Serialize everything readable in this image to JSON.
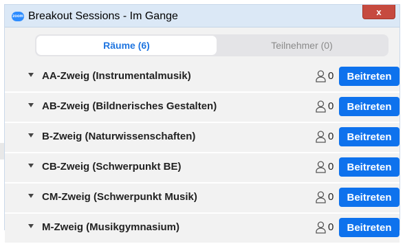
{
  "window": {
    "title": "Breakout Sessions - Im Gange",
    "app_icon_text": "zoom",
    "close_label": "x"
  },
  "tabs": [
    {
      "label": "Räume (6)",
      "active": true
    },
    {
      "label": "Teilnehmer (0)",
      "active": false
    }
  ],
  "rooms": [
    {
      "name": "AA-Zweig (Instrumentalmusik)",
      "count": "0",
      "join_label": "Beitreten"
    },
    {
      "name": "AB-Zweig (Bildnerisches Gestalten)",
      "count": "0",
      "join_label": "Beitreten"
    },
    {
      "name": "B-Zweig (Naturwissenschaften)",
      "count": "0",
      "join_label": "Beitreten"
    },
    {
      "name": "CB-Zweig (Schwerpunkt BE)",
      "count": "0",
      "join_label": "Beitreten"
    },
    {
      "name": "CM-Zweig (Schwerpunkt Musik)",
      "count": "0",
      "join_label": "Beitreten"
    },
    {
      "name": "M-Zweig (Musikgymnasium)",
      "count": "0",
      "join_label": "Beitreten"
    }
  ],
  "colors": {
    "accent": "#0e72ed",
    "tab_active_text": "#1f75e0",
    "close_button": "#c64a3f"
  }
}
